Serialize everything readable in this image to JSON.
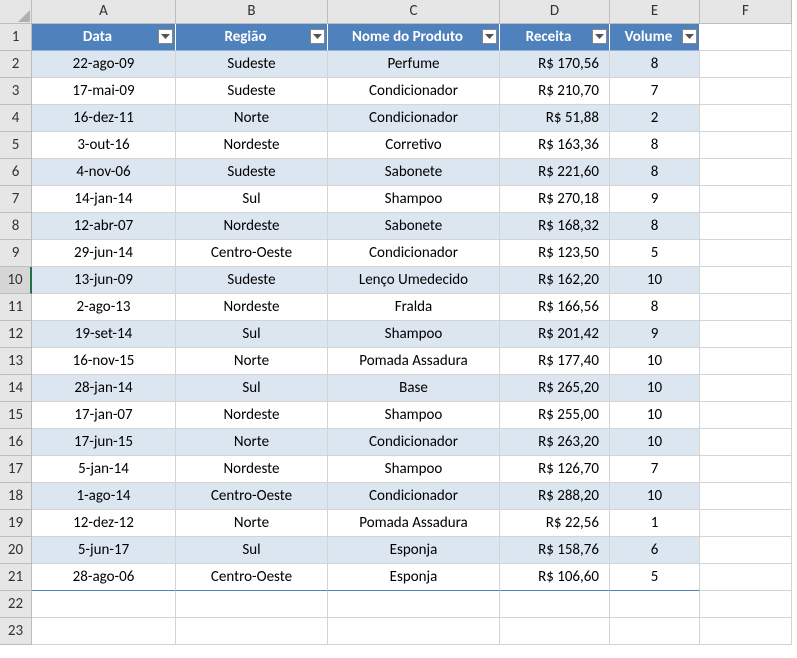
{
  "columns": [
    "A",
    "B",
    "C",
    "D",
    "E",
    "F"
  ],
  "rowNumbers": [
    "1",
    "2",
    "3",
    "4",
    "5",
    "6",
    "7",
    "8",
    "9",
    "10",
    "11",
    "12",
    "13",
    "14",
    "15",
    "16",
    "17",
    "18",
    "19",
    "20",
    "21",
    "22",
    "23"
  ],
  "selectedRow": 10,
  "headers": {
    "A": "Data",
    "B": "Região",
    "C": "Nome do Produto",
    "D": "Receita",
    "E": "Volume"
  },
  "rows": [
    {
      "data": "22-ago-09",
      "regiao": "Sudeste",
      "produto": "Perfume",
      "receita": "R$ 170,56",
      "volume": "8"
    },
    {
      "data": "17-mai-09",
      "regiao": "Sudeste",
      "produto": "Condicionador",
      "receita": "R$ 210,70",
      "volume": "7"
    },
    {
      "data": "16-dez-11",
      "regiao": "Norte",
      "produto": "Condicionador",
      "receita": "R$ 51,88",
      "volume": "2"
    },
    {
      "data": "3-out-16",
      "regiao": "Nordeste",
      "produto": "Corretivo",
      "receita": "R$ 163,36",
      "volume": "8"
    },
    {
      "data": "4-nov-06",
      "regiao": "Sudeste",
      "produto": "Sabonete",
      "receita": "R$ 221,60",
      "volume": "8"
    },
    {
      "data": "14-jan-14",
      "regiao": "Sul",
      "produto": "Shampoo",
      "receita": "R$ 270,18",
      "volume": "9"
    },
    {
      "data": "12-abr-07",
      "regiao": "Nordeste",
      "produto": "Sabonete",
      "receita": "R$ 168,32",
      "volume": "8"
    },
    {
      "data": "29-jun-14",
      "regiao": "Centro-Oeste",
      "produto": "Condicionador",
      "receita": "R$ 123,50",
      "volume": "5"
    },
    {
      "data": "13-jun-09",
      "regiao": "Sudeste",
      "produto": "Lenço Umedecido",
      "receita": "R$ 162,20",
      "volume": "10"
    },
    {
      "data": "2-ago-13",
      "regiao": "Nordeste",
      "produto": "Fralda",
      "receita": "R$ 166,56",
      "volume": "8"
    },
    {
      "data": "19-set-14",
      "regiao": "Sul",
      "produto": "Shampoo",
      "receita": "R$ 201,42",
      "volume": "9"
    },
    {
      "data": "16-nov-15",
      "regiao": "Norte",
      "produto": "Pomada Assadura",
      "receita": "R$ 177,40",
      "volume": "10"
    },
    {
      "data": "28-jan-14",
      "regiao": "Sul",
      "produto": "Base",
      "receita": "R$ 265,20",
      "volume": "10"
    },
    {
      "data": "17-jan-07",
      "regiao": "Nordeste",
      "produto": "Shampoo",
      "receita": "R$ 255,00",
      "volume": "10"
    },
    {
      "data": "17-jun-15",
      "regiao": "Norte",
      "produto": "Condicionador",
      "receita": "R$ 263,20",
      "volume": "10"
    },
    {
      "data": "5-jan-14",
      "regiao": "Nordeste",
      "produto": "Shampoo",
      "receita": "R$ 126,70",
      "volume": "7"
    },
    {
      "data": "1-ago-14",
      "regiao": "Centro-Oeste",
      "produto": "Condicionador",
      "receita": "R$ 288,20",
      "volume": "10"
    },
    {
      "data": "12-dez-12",
      "regiao": "Norte",
      "produto": "Pomada Assadura",
      "receita": "R$ 22,56",
      "volume": "1"
    },
    {
      "data": "5-jun-17",
      "regiao": "Sul",
      "produto": "Esponja",
      "receita": "R$ 158,76",
      "volume": "6"
    },
    {
      "data": "28-ago-06",
      "regiao": "Centro-Oeste",
      "produto": "Esponja",
      "receita": "R$ 106,60",
      "volume": "5"
    }
  ]
}
